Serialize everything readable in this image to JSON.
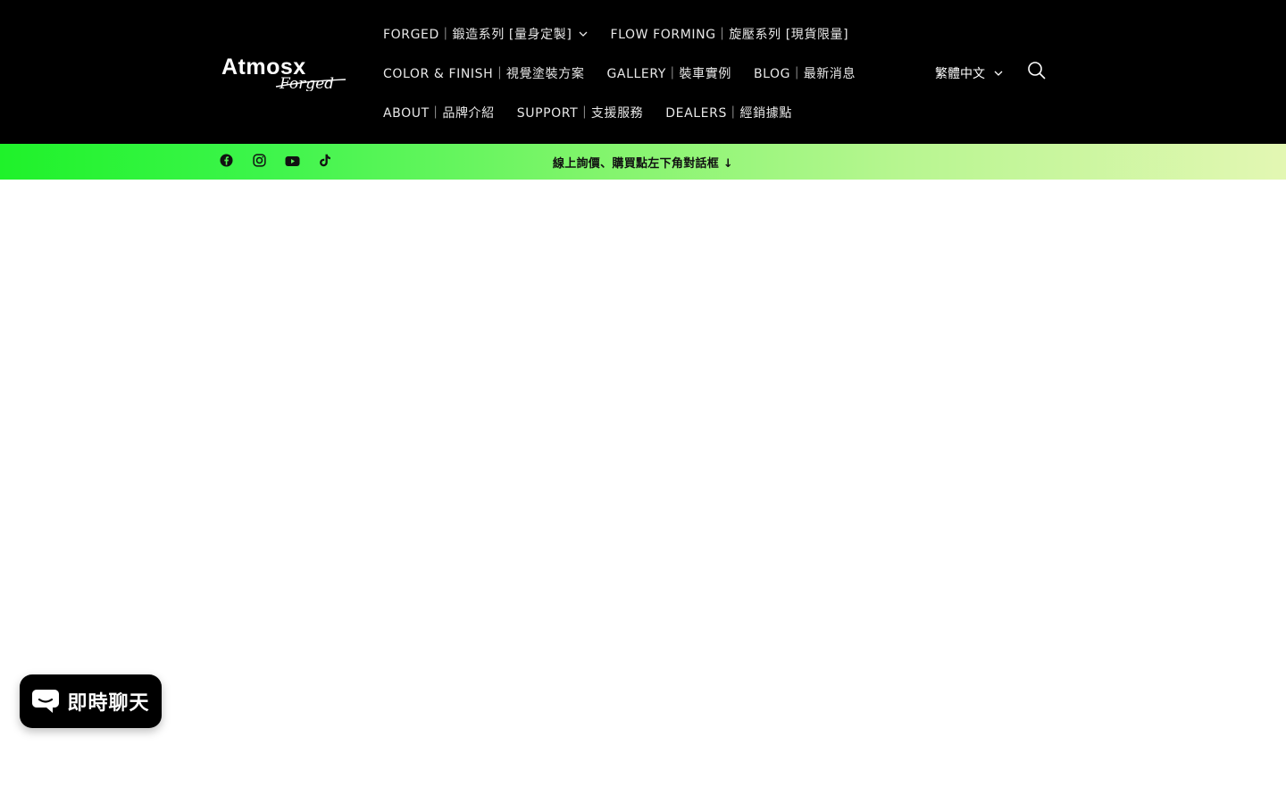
{
  "brand": {
    "logo_text": "Atmosx",
    "logo_script": "Forged",
    "colors": {
      "header_bg": "#000000",
      "accent_green": "#1ff22a",
      "announce_end": "#e3f7b3"
    }
  },
  "nav": {
    "items": [
      {
        "label": "FORGED｜鍛造系列 [量身定製]",
        "has_dropdown": true
      },
      {
        "label": "FLOW FORMING｜旋壓系列 [現貨限量]",
        "has_dropdown": false
      },
      {
        "label": "COLOR & FINISH｜視覺塗裝方案",
        "has_dropdown": false
      },
      {
        "label": "GALLERY｜裝車實例",
        "has_dropdown": false
      },
      {
        "label": "BLOG｜最新消息",
        "has_dropdown": false
      },
      {
        "label": "ABOUT｜品牌介紹",
        "has_dropdown": false
      },
      {
        "label": "SUPPORT｜支援服務",
        "has_dropdown": false
      },
      {
        "label": "DEALERS｜經銷據點",
        "has_dropdown": false
      }
    ]
  },
  "locale": {
    "label": "繁體中文",
    "icon": "chevron-down-icon"
  },
  "search": {
    "icon": "search-icon"
  },
  "social": {
    "items": [
      {
        "name": "facebook",
        "icon": "facebook-icon"
      },
      {
        "name": "instagram",
        "icon": "instagram-icon"
      },
      {
        "name": "youtube",
        "icon": "youtube-icon"
      },
      {
        "name": "tiktok",
        "icon": "tiktok-icon"
      }
    ]
  },
  "announcement": {
    "text": "線上詢價、購買點左下角對話框 ↓"
  },
  "chat": {
    "label": "即時聊天",
    "icon": "chat-bubble-icon"
  }
}
